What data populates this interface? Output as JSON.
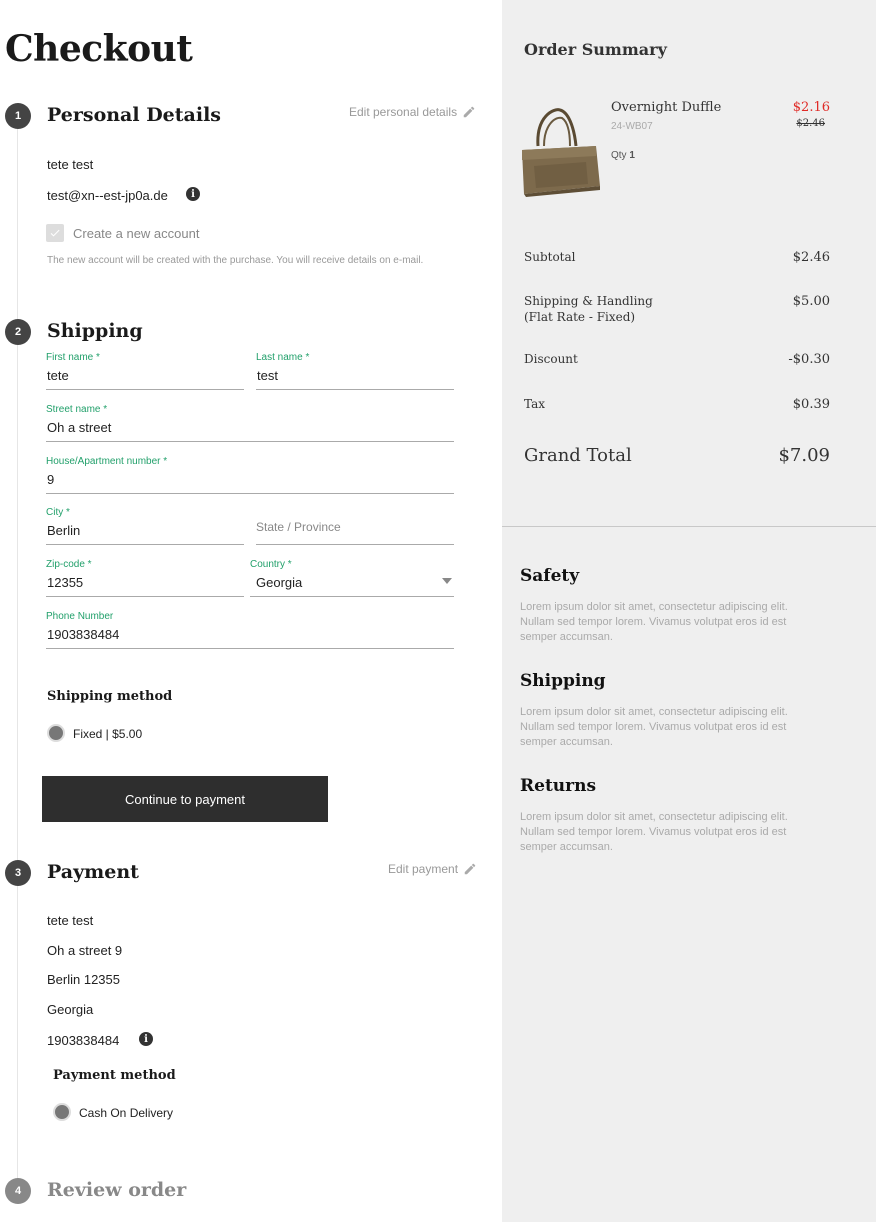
{
  "page_title": "Checkout",
  "personal": {
    "step": "1",
    "title": "Personal Details",
    "edit_label": "Edit personal details",
    "name": "tete test",
    "email": "test@xn--est-jp0a.de",
    "create_account_label": "Create a new account",
    "create_account_checked": true,
    "create_account_hint": "The new account will be created with the purchase. You will receive details on e-mail."
  },
  "shipping": {
    "step": "2",
    "title": "Shipping",
    "fields": {
      "first_name": {
        "label": "First name *",
        "value": "tete"
      },
      "last_name": {
        "label": "Last name *",
        "value": "test"
      },
      "street": {
        "label": "Street name *",
        "value": "Oh a street"
      },
      "house": {
        "label": "House/Apartment number *",
        "value": "9"
      },
      "city": {
        "label": "City *",
        "value": "Berlin"
      },
      "state": {
        "placeholder": "State / Province"
      },
      "zip": {
        "label": "Zip-code *",
        "value": "12355"
      },
      "country": {
        "label": "Country *",
        "value": "Georgia"
      },
      "phone": {
        "label": "Phone Number",
        "value": "1903838484"
      }
    },
    "method_heading": "Shipping method",
    "method_option": "Fixed | $5.00",
    "continue_button": "Continue to payment"
  },
  "payment": {
    "step": "3",
    "title": "Payment",
    "edit_label": "Edit payment",
    "address_lines": [
      "tete test",
      "Oh a street 9",
      "Berlin 12355",
      "Georgia",
      "1903838484"
    ],
    "method_heading": "Payment method",
    "method_option": "Cash On Delivery"
  },
  "review": {
    "step": "4",
    "title": "Review order"
  },
  "summary": {
    "title": "Order Summary",
    "product": {
      "name": "Overnight Duffle",
      "sku": "24-WB07",
      "qty_label": "Qty",
      "qty": "1",
      "price": "$2.16",
      "original_price": "$2.46"
    },
    "rows": [
      {
        "label": "Subtotal",
        "value": "$2.46"
      },
      {
        "label": "Shipping & Handling (Flat Rate - Fixed)",
        "value": "$5.00"
      },
      {
        "label": "Discount",
        "value": "-$0.30"
      },
      {
        "label": "Tax",
        "value": "$0.39"
      }
    ],
    "grand_total_label": "Grand Total",
    "grand_total_value": "$7.09"
  },
  "info_blocks": [
    {
      "heading": "Safety",
      "text": "Lorem ipsum dolor sit amet, consectetur adipiscing elit. Nullam sed tempor lorem. Vivamus volutpat eros id est semper accumsan."
    },
    {
      "heading": "Shipping",
      "text": "Lorem ipsum dolor sit amet, consectetur adipiscing elit. Nullam sed tempor lorem. Vivamus volutpat eros id est semper accumsan."
    },
    {
      "heading": "Returns",
      "text": "Lorem ipsum dolor sit amet, consectetur adipiscing elit. Nullam sed tempor lorem. Vivamus volutpat eros id est semper accumsan."
    }
  ],
  "colors": {
    "accent_green": "#22a06b",
    "sale_red": "#e02b27",
    "button_dark": "#2e2e2e",
    "panel_gray": "#efefef"
  }
}
